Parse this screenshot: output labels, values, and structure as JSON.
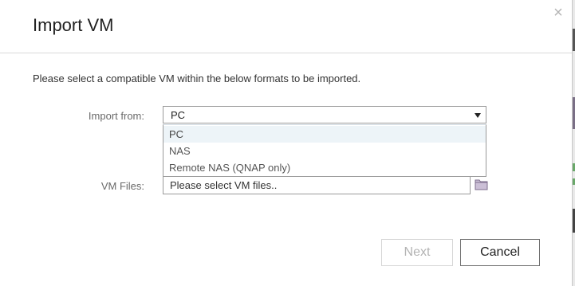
{
  "dialog": {
    "title": "Import VM",
    "close_icon": "close-icon",
    "instruction": "Please select a compatible VM within the below formats to be imported."
  },
  "form": {
    "import_from_label": "Import from:",
    "import_from_value": "PC",
    "import_from_options": [
      "PC",
      "NAS",
      "Remote NAS (QNAP only)"
    ],
    "vm_files_label": "VM Files:",
    "vm_files_placeholder": "Please select VM files.."
  },
  "buttons": {
    "next_label": "Next",
    "next_enabled": false,
    "cancel_label": "Cancel"
  },
  "colors": {
    "highlight_option": "#edf4f8",
    "folder_icon": "#cbbfd6"
  }
}
